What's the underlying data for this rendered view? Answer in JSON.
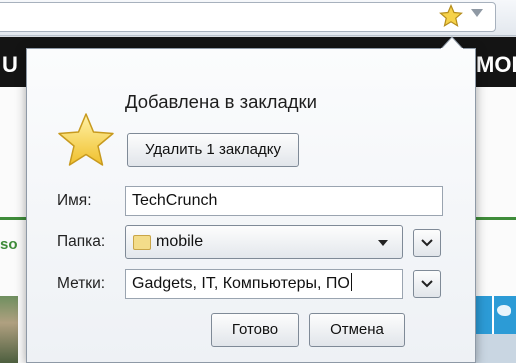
{
  "browser": {
    "nav_left_fragment": "U",
    "nav_right_fragment": "MOF",
    "side_fragment": "so"
  },
  "panel": {
    "title": "Добавлена в закладки",
    "remove_button": "Удалить 1 закладку",
    "name_label": "Имя:",
    "name_value": "TechCrunch",
    "folder_label": "Папка:",
    "folder_value": "mobile",
    "tags_label": "Метки:",
    "tags_value": "Gadgets, IT, Компьютеры, ПО",
    "done_button": "Готово",
    "cancel_button": "Отмена"
  },
  "colors": {
    "star_fill": "#f6d24a",
    "accent_green": "#3f8c3a"
  },
  "icons": {
    "bookmark_star": "star-icon",
    "folder": "folder-icon",
    "expand": "chevron-down-icon"
  }
}
